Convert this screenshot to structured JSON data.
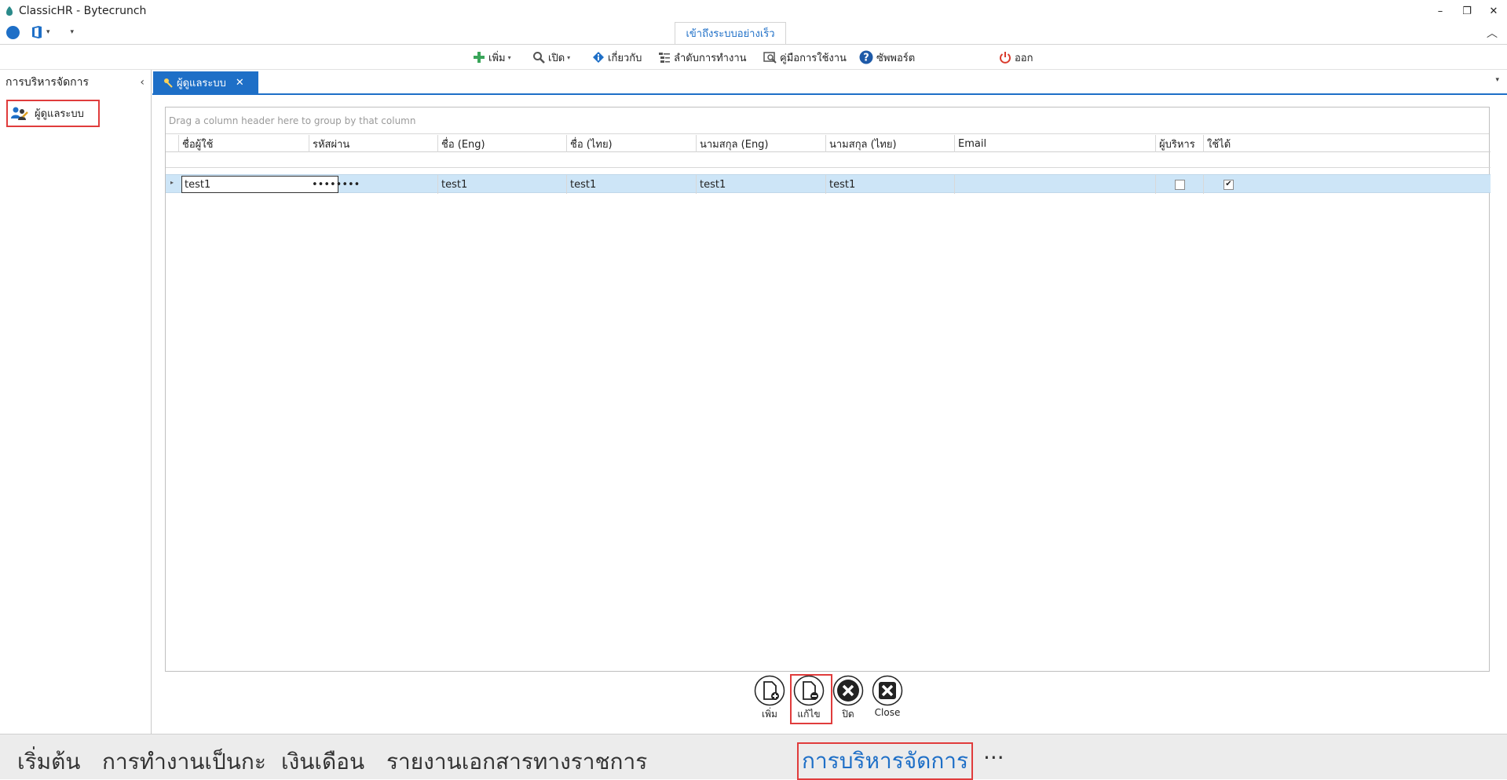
{
  "window": {
    "title": "ClassicHR - Bytecrunch",
    "controls": [
      "–",
      "❐",
      "✕"
    ]
  },
  "ribbon": {
    "tab_label": "เข้าถึงระบบอย่างเร็ว"
  },
  "toolbar": {
    "add": "เพิ่ม",
    "open": "เปิด",
    "about": "เกี่ยวกับ",
    "workflow": "ลำดับการทำงาน",
    "manual": "คู่มือการใช้งาน",
    "support": "ซัพพอร์ต",
    "logout": "ออก"
  },
  "sidebar": {
    "heading": "การบริหารจัดการ",
    "item": "ผู้ดูแลระบบ"
  },
  "doc_tab": {
    "label": "ผู้ดูแลระบบ"
  },
  "grid": {
    "group_hint": "Drag a column header here to group by that column",
    "columns": [
      "ชื่อผู้ใช้",
      "รหัสผ่าน",
      "ชื่อ (Eng)",
      "ชื่อ (ไทย)",
      "นามสกุล (Eng)",
      "นามสกุล (ไทย)",
      "Email",
      "ผู้บริหาร",
      "ใช้ได้"
    ],
    "row": {
      "username": "test1",
      "password": "••••••••",
      "first_eng": "test1",
      "first_thai": "test1",
      "last_eng": "test1",
      "last_thai": "test1",
      "email": "",
      "is_admin": false,
      "enabled": true
    }
  },
  "actions": {
    "add": "เพิ่ม",
    "edit": "แก้ไข",
    "close_th": "ปิด",
    "close_en": "Close"
  },
  "bottom_nav": {
    "start": "เริ่มต้น",
    "shift": "การทำงานเป็นกะ",
    "salary": "เงินเดือน",
    "gov_reports": "รายงานเอกสารทางราชการ",
    "management": "การบริหารจัดการ",
    "more": "···"
  },
  "colors": {
    "accent": "#1e6fc7",
    "highlight": "#e03c3c",
    "selected_row": "#cde5f7"
  }
}
